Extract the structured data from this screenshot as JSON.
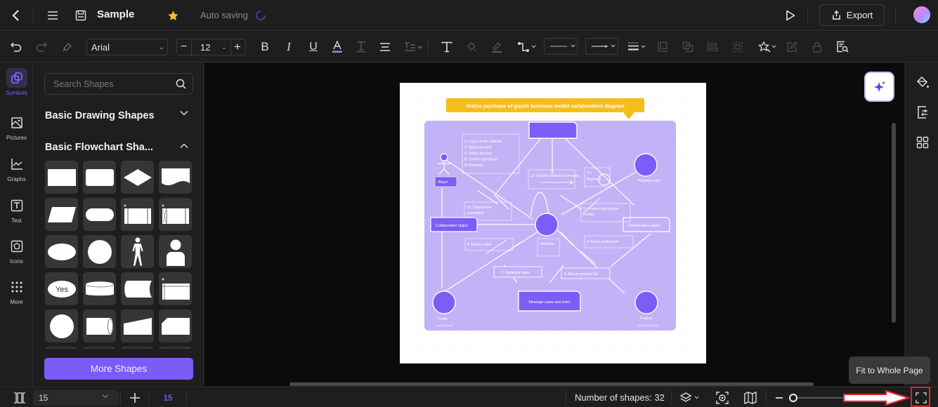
{
  "app": {
    "document_title": "Sample",
    "autosave_status": "Auto saving",
    "export_label": "Export"
  },
  "topbar": {
    "icons": [
      "back-icon",
      "menu-icon",
      "save-icon",
      "star-icon",
      "loading-spinner-icon",
      "play-icon",
      "export-icon",
      "avatar"
    ]
  },
  "toolbar": {
    "font_family": "Arial",
    "font_size": "12",
    "icons": [
      "undo-icon",
      "redo-icon",
      "format-painter-icon",
      "bold-icon",
      "italic-icon",
      "underline-icon",
      "font-color-icon",
      "text-style-icon",
      "align-icon",
      "line-spacing-icon",
      "text-icon",
      "fill-icon",
      "line-color-icon",
      "connector-icon",
      "line-style-select",
      "arrow-style-select",
      "line-weight-icon",
      "bring-front-icon",
      "send-back-icon",
      "align-objects-icon",
      "group-icon",
      "magic-icon",
      "edit-icon",
      "lock-icon",
      "find-icon"
    ]
  },
  "rail": {
    "items": [
      {
        "label": "Symbols",
        "icon": "symbols-icon",
        "active": true
      },
      {
        "label": "Pictures",
        "icon": "pictures-icon"
      },
      {
        "label": "Graphs",
        "icon": "graphs-icon"
      },
      {
        "label": "Text",
        "icon": "text-icon"
      },
      {
        "label": "Icons",
        "icon": "icons-icon"
      },
      {
        "label": "More",
        "icon": "more-icon"
      }
    ]
  },
  "panel": {
    "search_placeholder": "Search Shapes",
    "sections": [
      {
        "title": "Basic Drawing Shapes",
        "expanded": false
      },
      {
        "title": "Basic Flowchart Sha...",
        "expanded": true
      }
    ],
    "shapes": [
      "process",
      "rounded-rectangle",
      "decision",
      "document",
      "data",
      "terminator",
      "predefined-process",
      "internal-storage",
      "ellipse",
      "circle",
      "actor",
      "user",
      "yes-label",
      "cylinder",
      "stored-data",
      "card-table",
      "connector",
      "direct-access-storage",
      "manual-input",
      "card"
    ],
    "yes_label": "Yes",
    "more_shapes_label": "More Shapes"
  },
  "diagram": {
    "title": "Online purchase of goods business model collaboration diagram",
    "colors": {
      "title_bg": "#f7be1a",
      "bg": "#c2b3f7",
      "node": "#7b5ef7",
      "line": "#ffffff"
    },
    "actor_label": ": Buyer",
    "messages_box": [
      "1: Log in to the website",
      "2: Query product",
      "5: Select product",
      "6: Confirm purchase",
      "9: Payment"
    ],
    "display_results": "12: Display transaction results",
    "payment": "10: Payment",
    "payment_card": ": Payment card",
    "transaction_completed": "13: Transaction completed",
    "return_transaction": "11: Return transaction results",
    "collab_left": "Collaboration object",
    "collab_right": "Collaboration object",
    "website": ": Website",
    "return_order": "8: Return order",
    "read_product_list": "3: Read product list",
    "generate_order": "7: Generate order",
    "return_product_list": "4: Return product list",
    "message_note": "Message name and order",
    "order": ": Order",
    "product": ": Product"
  },
  "bottombar": {
    "page_select": "15",
    "page_tab": "15",
    "shape_count": "Number of shapes: 32",
    "tooltip": "Fit to Whole Page",
    "zoom_fraction": 0.0
  }
}
